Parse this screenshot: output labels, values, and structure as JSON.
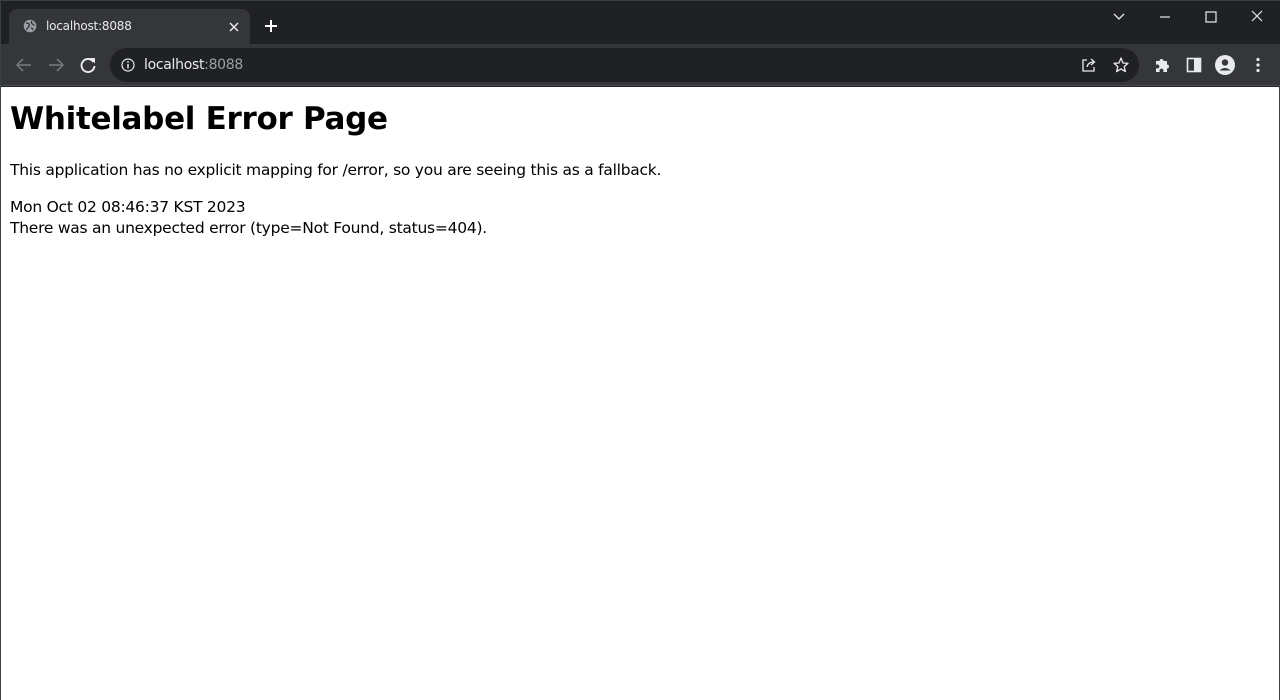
{
  "browser": {
    "tab": {
      "title": "localhost:8088"
    },
    "omnibox": {
      "host": "localhost",
      "port": ":8088"
    }
  },
  "page": {
    "heading": "Whitelabel Error Page",
    "message": "This application has no explicit mapping for /error, so you are seeing this as a fallback.",
    "timestamp": "Mon Oct 02 08:46:37 KST 2023",
    "error": "There was an unexpected error (type=Not Found, status=404)."
  },
  "icons": {
    "tab_favicon": "globe-icon",
    "tab_close": "close-icon",
    "new_tab": "plus-icon",
    "tab_search": "chevron-down-icon",
    "minimize": "minimize-icon",
    "maximize": "maximize-icon",
    "close_window": "close-icon",
    "back": "back-arrow-icon",
    "forward": "forward-arrow-icon",
    "reload": "reload-icon",
    "site_info": "info-icon",
    "share": "share-icon",
    "bookmark": "star-icon",
    "extensions": "puzzle-icon",
    "side_panel": "side-panel-icon",
    "profile": "avatar-icon",
    "menu": "kebab-menu-icon"
  },
  "colors": {
    "frame": "#202124",
    "toolbar": "#35363a",
    "text_light": "#e8eaed",
    "text_dim": "#9aa0a6",
    "page_bg": "#ffffff"
  }
}
